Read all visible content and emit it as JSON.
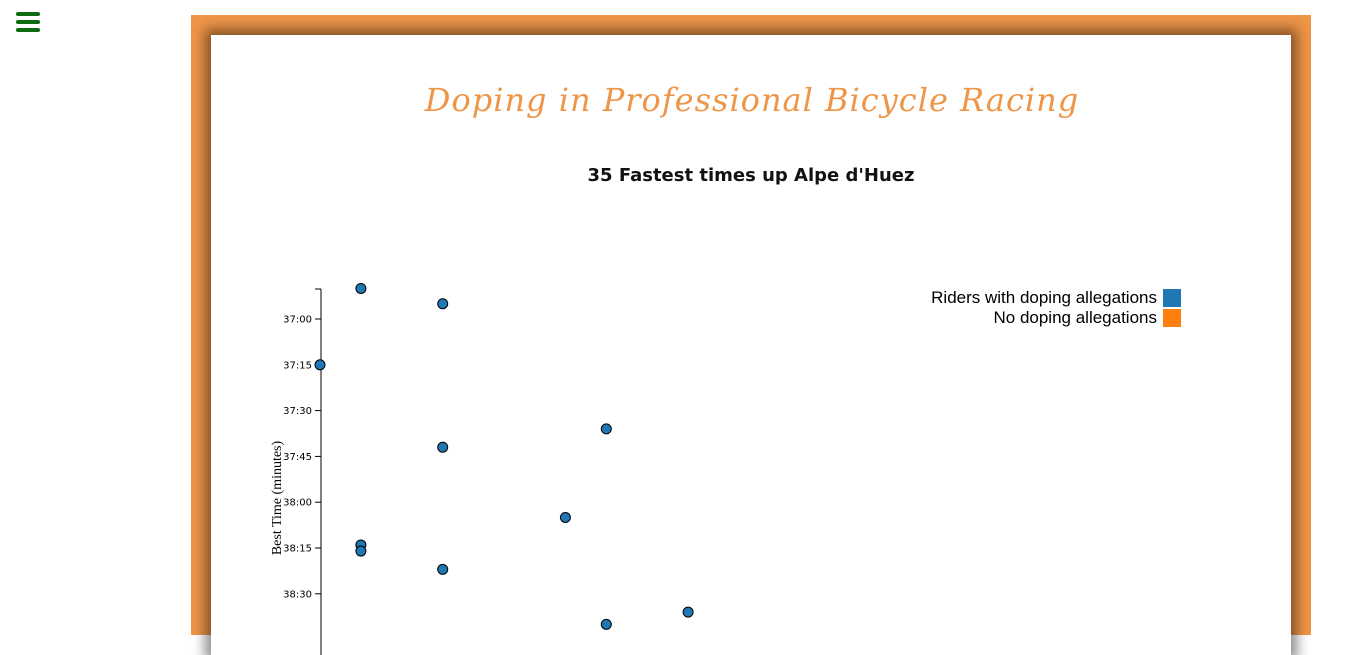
{
  "nav": {
    "menu_icon": "hamburger-menu-icon",
    "menu_color": "#0f6b12"
  },
  "page": {
    "title": "Doping in Professional Bicycle Racing",
    "frame_color": "#ef9548"
  },
  "chart_data": {
    "type": "scatter",
    "title": "35 Fastest times up Alpe d'Huez",
    "xlabel": "",
    "ylabel": "Best Time (minutes)",
    "y_reversed": true,
    "y_unit": "seconds",
    "ylim_visible": [
      2210,
      2330
    ],
    "xlim_visible": [
      1994,
      2004
    ],
    "y_ticks": [
      {
        "value": 2220,
        "label": "37:00"
      },
      {
        "value": 2235,
        "label": "37:15"
      },
      {
        "value": 2250,
        "label": "37:30"
      },
      {
        "value": 2265,
        "label": "37:45"
      },
      {
        "value": 2280,
        "label": "38:00"
      },
      {
        "value": 2295,
        "label": "38:15"
      },
      {
        "value": 2310,
        "label": "38:30"
      }
    ],
    "legend": {
      "placement": "top-right",
      "entries": [
        {
          "label": "Riders with doping allegations",
          "color": "#1f77b4"
        },
        {
          "label": "No doping allegations",
          "color": "#ff7f0e"
        }
      ]
    },
    "series": [
      {
        "name": "Riders with doping allegations",
        "color": "#1f77b4",
        "points": [
          {
            "x": 1995,
            "y": 2210
          },
          {
            "x": 1997,
            "y": 2215
          },
          {
            "x": 1994,
            "y": 2235
          },
          {
            "x": 2001,
            "y": 2256
          },
          {
            "x": 1997,
            "y": 2262
          },
          {
            "x": 2000,
            "y": 2285
          },
          {
            "x": 1995,
            "y": 2294
          },
          {
            "x": 1995,
            "y": 2296
          },
          {
            "x": 1997,
            "y": 2302
          },
          {
            "x": 2003,
            "y": 2316
          },
          {
            "x": 2001,
            "y": 2320
          }
        ]
      }
    ]
  }
}
